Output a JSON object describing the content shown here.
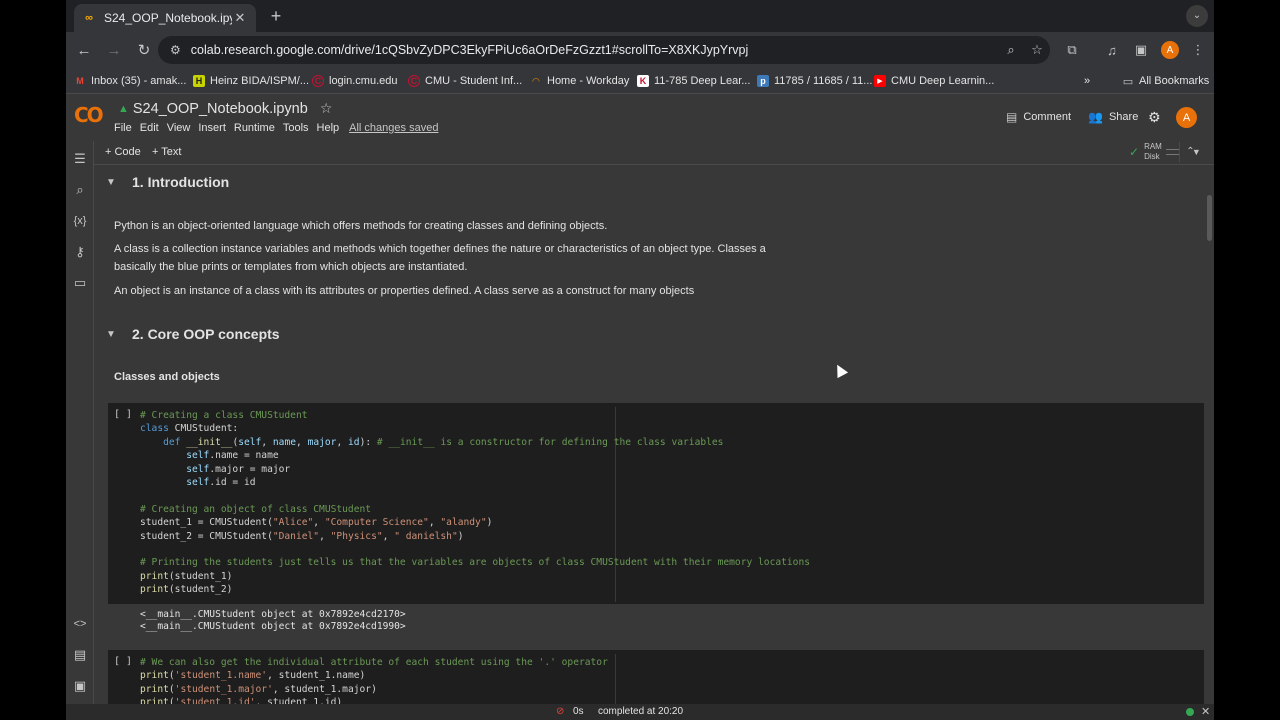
{
  "browser": {
    "tab_title": "S24_OOP_Notebook.ipynb -",
    "tab_close": "✕",
    "new_tab": "+",
    "url": "colab.research.google.com/drive/1cQSbvZyDPC3EkyFPiUc6aOrDeFzGzzt1#scrollTo=X8XKJypYrvpj",
    "profile_initial": "A",
    "bookmarks": [
      {
        "label": "Inbox (35) - amak...",
        "icon": "gmail-icon",
        "color": "#ea4335"
      },
      {
        "label": "Heinz BIDA/ISPM/...",
        "icon": "heinz-icon",
        "color": "#c8d400"
      },
      {
        "label": "login.cmu.edu",
        "icon": "cmu-icon",
        "color": "#c41230"
      },
      {
        "label": "CMU - Student Inf...",
        "icon": "cmu-icon",
        "color": "#c41230"
      },
      {
        "label": "Home - Workday",
        "icon": "workday-icon",
        "color": "#f38b00"
      },
      {
        "label": "11-785 Deep Lear...",
        "icon": "course-icon",
        "color": "#ffffff"
      },
      {
        "label": "11785 / 11685 / 11...",
        "icon": "piazza-icon",
        "color": "#3e7ab8"
      },
      {
        "label": "CMU Deep Learnin...",
        "icon": "youtube-icon",
        "color": "#ff0000"
      }
    ],
    "more_bookmarks": "»",
    "all_bookmarks": "All Bookmarks"
  },
  "colab": {
    "logo": "CO",
    "notebook_title": "S24_OOP_Notebook.ipynb",
    "menu": [
      "File",
      "Edit",
      "View",
      "Insert",
      "Runtime",
      "Tools",
      "Help"
    ],
    "save_status": "All changes saved",
    "comment_label": "Comment",
    "share_label": "Share",
    "user_initial": "A",
    "add_code": "+ Code",
    "add_text": "+ Text",
    "ram_label": "RAM",
    "disk_label": "Disk"
  },
  "notebook": {
    "section1_title": "1. Introduction",
    "para1": "Python is an object-oriented language which offers methods for creating classes and defining objects.",
    "para2a": "A class is a collection instance variables and methods which together defines the nature or characteristics of an object type. Classes a",
    "para2b": "basically the blue prints or templates from which objects are instantiated.",
    "para3": "An object is an instance of a class with its attributes or properties defined. A class serve as a construct for many objects",
    "section2_title": "2. Core OOP concepts",
    "subhead": "Classes and objects",
    "run_indicator": "[ ]",
    "output1": "<__main__.CMUStudent object at 0x7892e4cd2170>",
    "output2": "<__main__.CMUStudent object at 0x7892e4cd1990>"
  },
  "status": {
    "seconds": "0s",
    "completed": "completed at 20:20"
  }
}
